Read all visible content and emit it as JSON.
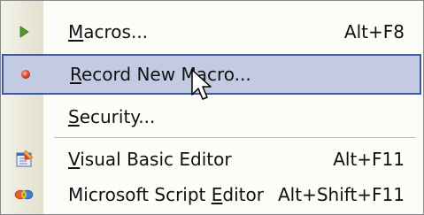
{
  "menu": {
    "items": [
      {
        "label": "Macros...",
        "mnemonic": "M",
        "rest": "acros...",
        "shortcut": "Alt+F8",
        "icon": "play-arrow-icon",
        "highlighted": false
      },
      {
        "label": "Record New Macro...",
        "mnemonic": "R",
        "rest": "ecord New Macro...",
        "shortcut": "",
        "icon": "record-dot-icon",
        "highlighted": true
      },
      {
        "label": "Security...",
        "mnemonic": "S",
        "rest": "ecurity...",
        "shortcut": "",
        "icon": "",
        "highlighted": false
      },
      {
        "label": "Visual Basic Editor",
        "mnemonic": "V",
        "rest": "isual Basic Editor",
        "shortcut": "Alt+F11",
        "icon": "visual-basic-editor-icon",
        "highlighted": false
      },
      {
        "label": "Microsoft Script Editor",
        "prefix": "Microsoft Script ",
        "mnemonic": "E",
        "rest": "ditor",
        "shortcut": "Alt+Shift+F11",
        "icon": "script-editor-icon",
        "highlighted": false
      }
    ]
  },
  "colors": {
    "highlight_fill": "#c3cbe2",
    "highlight_border": "#3d5aa8",
    "play_arrow": "#4f9a2a",
    "record_dot": "#e2503a"
  }
}
